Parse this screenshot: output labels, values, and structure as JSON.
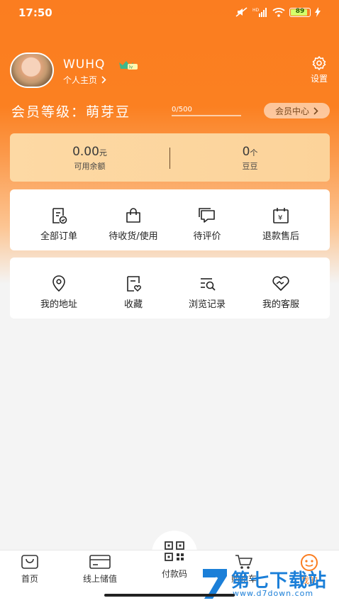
{
  "status_bar": {
    "time": "17:50",
    "battery": "89"
  },
  "profile": {
    "username": "WUHQ",
    "homepage_link": "个人主页",
    "settings_label": "设置"
  },
  "membership": {
    "level_text": "会员等级：萌芽豆",
    "progress_text": "0/500",
    "progress": 0,
    "member_center": "会员中心"
  },
  "balance": {
    "amount": "0.00",
    "amount_unit": "元",
    "amount_label": "可用余额",
    "beans": "0",
    "beans_unit": "个",
    "beans_label": "豆豆"
  },
  "orders": [
    {
      "label": "全部订单",
      "icon": "order-list-icon"
    },
    {
      "label": "待收货/使用",
      "icon": "shopping-bag-icon"
    },
    {
      "label": "待评价",
      "icon": "comment-icon"
    },
    {
      "label": "退款售后",
      "icon": "refund-calendar-icon"
    }
  ],
  "services": [
    {
      "label": "我的地址",
      "icon": "location-pin-icon"
    },
    {
      "label": "收藏",
      "icon": "favorite-icon"
    },
    {
      "label": "浏览记录",
      "icon": "browse-history-icon"
    },
    {
      "label": "我的客服",
      "icon": "customer-service-icon"
    }
  ],
  "tabbar": [
    {
      "label": "首页",
      "icon": "home-bag-icon"
    },
    {
      "label": "线上储值",
      "icon": "card-icon"
    },
    {
      "label": "付款码",
      "icon": "qr-code-icon"
    },
    {
      "label": "购物车",
      "icon": "cart-icon"
    },
    {
      "label": "我的",
      "icon": "profile-face-icon"
    }
  ],
  "watermark": {
    "title": "第七下载站",
    "url": "www.d7down.com"
  },
  "colors": {
    "primary": "#fb7d20",
    "card_gold": "#fdd9a4",
    "active_tab": "#fb7d20"
  }
}
